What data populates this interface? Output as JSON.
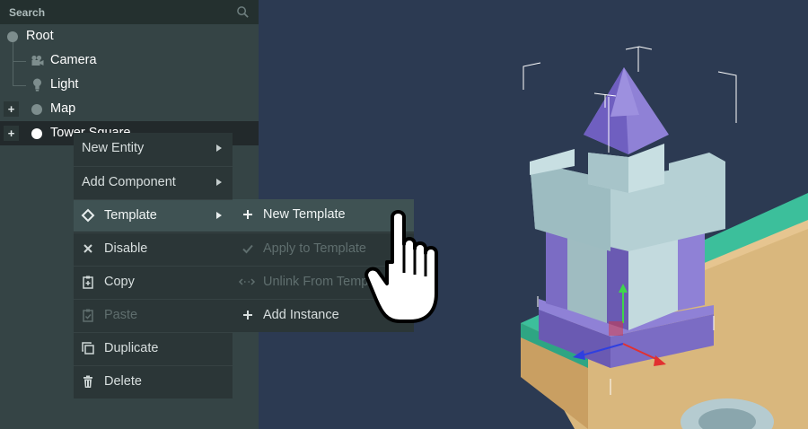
{
  "search": {
    "placeholder": "Search",
    "icon": "search-icon"
  },
  "hierarchy": {
    "items": [
      {
        "label": "Root",
        "icon": "entity-dot-icon"
      },
      {
        "label": "Camera",
        "icon": "camera-icon"
      },
      {
        "label": "Light",
        "icon": "lightbulb-icon"
      },
      {
        "label": "Map",
        "icon": "entity-dot-icon"
      },
      {
        "label": "Tower Square",
        "icon": "entity-dot-icon",
        "selected": true
      }
    ],
    "expand_symbol": "+"
  },
  "context_menu": {
    "items": [
      {
        "label": "New Entity",
        "has_submenu": true
      },
      {
        "label": "Add Component",
        "has_submenu": true
      },
      {
        "label": "Template",
        "icon": "template-diamond-icon",
        "has_submenu": true,
        "highlighted": true
      },
      {
        "label": "Disable",
        "icon": "close-icon"
      },
      {
        "label": "Copy",
        "icon": "copy-icon"
      },
      {
        "label": "Paste",
        "icon": "paste-icon",
        "disabled": true
      },
      {
        "label": "Duplicate",
        "icon": "duplicate-icon"
      },
      {
        "label": "Delete",
        "icon": "trash-icon"
      }
    ]
  },
  "template_submenu": {
    "items": [
      {
        "label": "New Template",
        "icon": "plus-icon",
        "highlighted": true
      },
      {
        "label": "Apply to Template",
        "icon": "check-icon",
        "disabled": true
      },
      {
        "label": "Unlink From Template",
        "icon": "unlink-icon",
        "disabled": true
      },
      {
        "label": "Add Instance",
        "icon": "plus-icon"
      }
    ]
  },
  "colors": {
    "panel_bg": "#354445",
    "menu_bg": "#2b3637",
    "menu_highlight": "#3f5253",
    "viewport_bg": "#2c3a52",
    "tower_purple": "#7b6cc4",
    "tower_stone": "#b5d0d4",
    "ground_green": "#3cbf9b",
    "ground_sand": "#d9b77d"
  },
  "cursor": "pointing-hand-cursor"
}
